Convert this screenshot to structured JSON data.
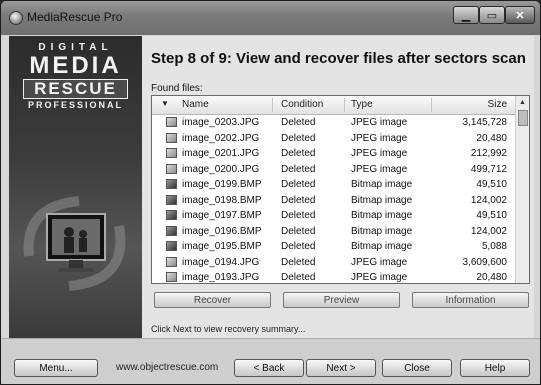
{
  "window": {
    "title": "MediaRescue Pro",
    "controls": {
      "minimize_icon": "minimize-icon",
      "maximize_icon": "maximize-icon",
      "close_icon": "close-icon"
    }
  },
  "sidebar": {
    "logo": {
      "line1": "DIGITAL",
      "line2": "MEDIA",
      "line3": "RESCUE",
      "line4": "PROFESSIONAL"
    }
  },
  "main": {
    "step_title": "Step 8 of 9: View and recover files after sectors scan",
    "found_files_label": "Found files:",
    "columns": {
      "name": "Name",
      "condition": "Condition",
      "type": "Type",
      "size": "Size"
    },
    "files": [
      {
        "name": "image_0203.JPG",
        "condition": "Deleted",
        "type": "JPEG image",
        "size": "3,145,728",
        "icon": "jpeg"
      },
      {
        "name": "image_0202.JPG",
        "condition": "Deleted",
        "type": "JPEG image",
        "size": "20,480",
        "icon": "jpeg"
      },
      {
        "name": "image_0201.JPG",
        "condition": "Deleted",
        "type": "JPEG image",
        "size": "212,992",
        "icon": "jpeg"
      },
      {
        "name": "image_0200.JPG",
        "condition": "Deleted",
        "type": "JPEG image",
        "size": "499,712",
        "icon": "jpeg"
      },
      {
        "name": "image_0199.BMP",
        "condition": "Deleted",
        "type": "Bitmap image",
        "size": "49,510",
        "icon": "bmp"
      },
      {
        "name": "image_0198.BMP",
        "condition": "Deleted",
        "type": "Bitmap image",
        "size": "124,002",
        "icon": "bmp"
      },
      {
        "name": "image_0197.BMP",
        "condition": "Deleted",
        "type": "Bitmap image",
        "size": "49,510",
        "icon": "bmp"
      },
      {
        "name": "image_0196.BMP",
        "condition": "Deleted",
        "type": "Bitmap image",
        "size": "124,002",
        "icon": "bmp"
      },
      {
        "name": "image_0195.BMP",
        "condition": "Deleted",
        "type": "Bitmap image",
        "size": "5,088",
        "icon": "bmp"
      },
      {
        "name": "image_0194.JPG",
        "condition": "Deleted",
        "type": "JPEG image",
        "size": "3,609,600",
        "icon": "jpeg"
      },
      {
        "name": "image_0193.JPG",
        "condition": "Deleted",
        "type": "JPEG image",
        "size": "20,480",
        "icon": "jpeg"
      }
    ],
    "actions": {
      "recover": "Recover",
      "preview": "Preview",
      "information": "Information"
    },
    "hint": "Click Next to view recovery summary..."
  },
  "footer": {
    "menu": "Menu...",
    "website": "www.objectrescue.com",
    "back": "< Back",
    "next": "Next >",
    "close": "Close",
    "help": "Help"
  }
}
